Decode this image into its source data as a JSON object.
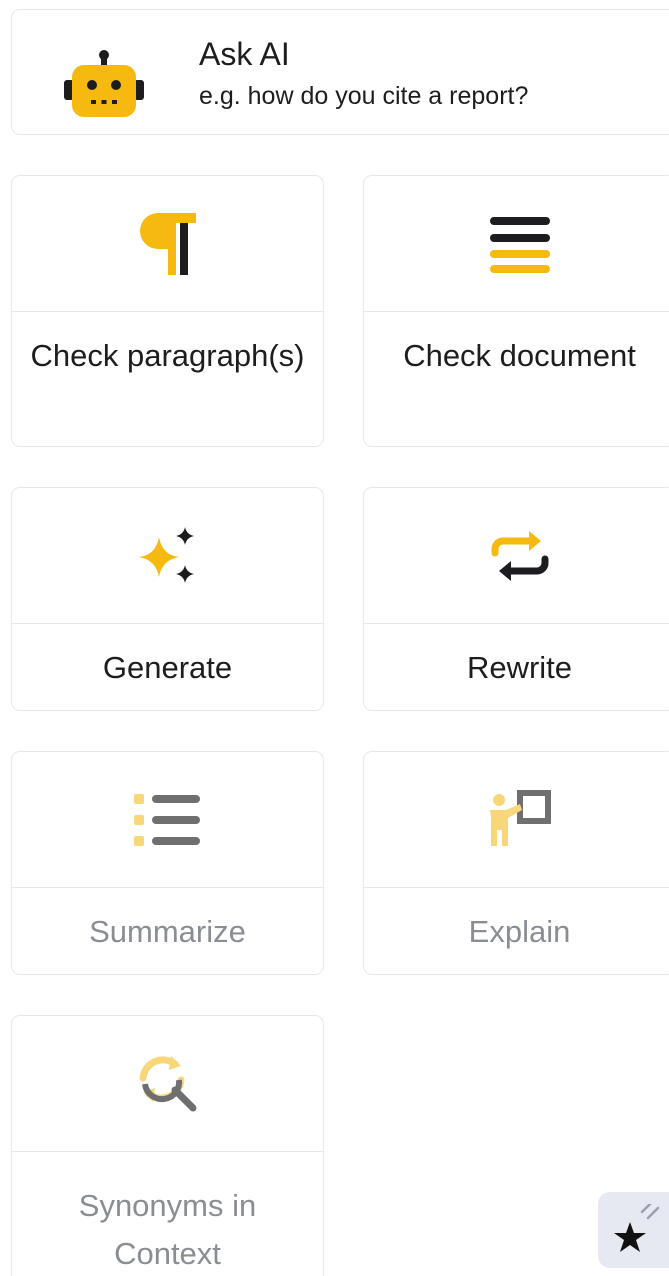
{
  "ask_ai": {
    "title": "Ask AI",
    "subtitle": "e.g. how do you cite a report?"
  },
  "cards": [
    {
      "label": "Check paragraph(s)",
      "icon": "pilcrow-icon",
      "enabled": true
    },
    {
      "label": "Check document",
      "icon": "document-lines-icon",
      "enabled": true
    },
    {
      "label": "Generate",
      "icon": "sparkles-icon",
      "enabled": true
    },
    {
      "label": "Rewrite",
      "icon": "rewrite-arrows-icon",
      "enabled": true
    },
    {
      "label": "Summarize",
      "icon": "list-icon",
      "enabled": false
    },
    {
      "label": "Explain",
      "icon": "presenter-icon",
      "enabled": false
    },
    {
      "label": "Synonyms in Context",
      "icon": "synonym-search-icon",
      "enabled": false
    }
  ],
  "colors": {
    "accent": "#f5b90f",
    "accent_light": "#f8d77a",
    "icon_dark": "#1d1d1f",
    "icon_disabled": "#6f6f6f",
    "border": "#e6e8ee",
    "fab_bg": "#e6e9f2"
  },
  "fab": {
    "icon": "shooting-star-icon"
  }
}
